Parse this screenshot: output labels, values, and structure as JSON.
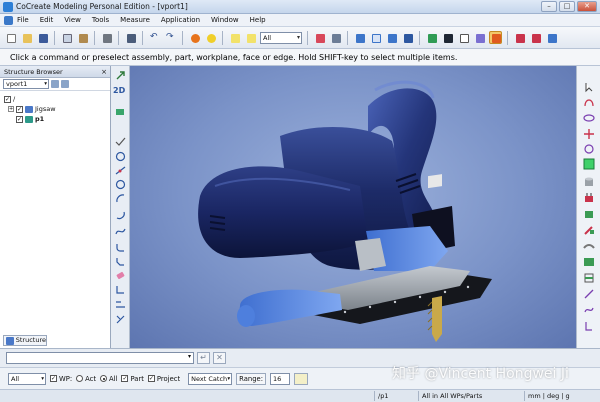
{
  "window": {
    "title": "CoCreate Modeling Personal Edition - [vport1]",
    "buttons": [
      "–",
      "□",
      "✕"
    ]
  },
  "menu": [
    "File",
    "Edit",
    "View",
    "Tools",
    "Measure",
    "Application",
    "Window",
    "Help"
  ],
  "toolbar": {
    "filter_value": "All"
  },
  "prompt": {
    "text": "Click a command or preselect assembly, part, workplane, face or edge. Hold SHIFT-key to select multiple items."
  },
  "structure_browser": {
    "title": "Structure Browser",
    "viewport_select": "vport1",
    "tree": [
      {
        "label": "/",
        "level": 0,
        "checked": true
      },
      {
        "label": "Jigsaw",
        "level": 1,
        "checked": true
      },
      {
        "label": "p1",
        "level": 1,
        "checked": true
      }
    ],
    "tab_label": "Structure"
  },
  "left_toolbar": {
    "label_2d": "2D"
  },
  "viewport": {
    "name": "vport1"
  },
  "bottom": {
    "filter_value": "All",
    "wp_label": "WP:",
    "act_label": "Act",
    "all_label": "All",
    "part_label": "Part",
    "project_label": "Project",
    "catch_value": "Next Catch",
    "range_label": "Range:",
    "range_value": "16"
  },
  "status": {
    "part": "/p1",
    "scope": "All in All WPs/Parts",
    "units": "mm | deg | g"
  },
  "watermark": "知乎 @Vincent Hongwei Ji",
  "colors": {
    "body_blue": "#1c2a63",
    "light_blue": "#3f6fd0",
    "base_gray": "#9aa1a8",
    "viewport_bg": "#8aa2d2"
  }
}
